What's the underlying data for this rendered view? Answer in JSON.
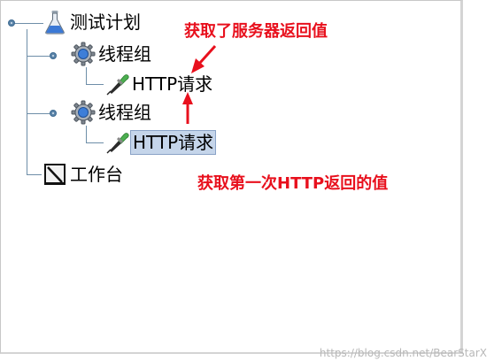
{
  "tree": {
    "root": {
      "label": "测试计划",
      "icon": "test-plan-flask-icon"
    },
    "groups": [
      {
        "label": "线程组",
        "icon": "thread-group-gear-icon",
        "child": {
          "label": "HTTP请求",
          "icon": "http-request-dropper-icon",
          "selected": false
        }
      },
      {
        "label": "线程组",
        "icon": "thread-group-gear-icon",
        "child": {
          "label": "HTTP请求",
          "icon": "http-request-dropper-icon",
          "selected": true
        }
      }
    ],
    "workbench": {
      "label": "工作台",
      "icon": "workbench-icon"
    }
  },
  "annotations": {
    "top": "获取了服务器返回值",
    "bottom": "获取第一次HTTP返回的值"
  },
  "watermark": "https://blog.csdn.net/BearStarX",
  "colors": {
    "annotation": "#e8101d",
    "selection": "#c5d5ea",
    "tree_line": "#6e8ea8"
  }
}
